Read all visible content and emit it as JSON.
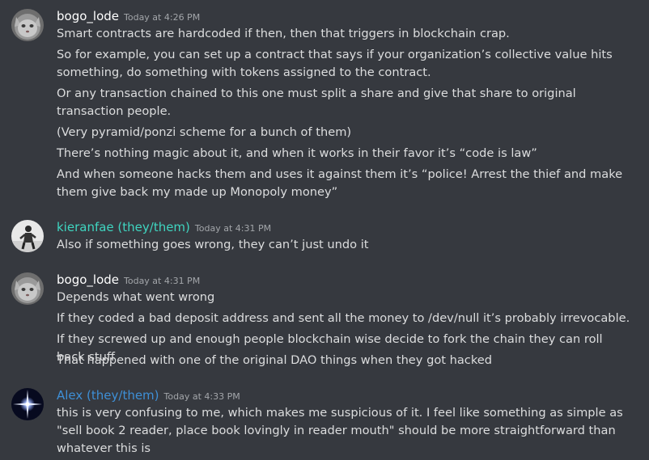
{
  "colors": {
    "background": "#36393f",
    "text": "#dcddde",
    "timestamp": "#a3a6aa",
    "username_default": "#ffffff",
    "username_teal": "#3fd5c0",
    "username_blue": "#3e8fd6"
  },
  "messages": [
    {
      "author": "bogo_lode",
      "author_color": "#ffffff",
      "avatar_icon": "cat-avatar-icon",
      "timestamp": "Today at 4:26 PM",
      "lines": [
        "Smart contracts are hardcoded if then, then that triggers in blockchain crap.",
        "So for example, you can set up a contract that says if your organization’s collective value hits something, do something with tokens assigned to the contract.",
        "Or any transaction chained to this one must split a share and give that share to original transaction people.",
        "(Very pyramid/ponzi scheme for a bunch of them)",
        "There’s nothing magic about it, and when it works in their favor it’s “code is law”",
        "And when someone hacks them and uses it against them it’s “police! Arrest the thief and make them give back my made up Monopoly money”"
      ]
    },
    {
      "author": "kieranfae (they/them)",
      "author_color": "#3fd5c0",
      "avatar_icon": "person-photo-avatar-icon",
      "timestamp": "Today at 4:31 PM",
      "lines": [
        "Also if something goes wrong, they can’t just undo it"
      ]
    },
    {
      "author": "bogo_lode",
      "author_color": "#ffffff",
      "avatar_icon": "cat-avatar-icon",
      "timestamp": "Today at 4:31 PM",
      "lines": [
        "Depends what went wrong",
        "If they coded a bad deposit address and sent all the money to /dev/null it’s probably irrevocable.",
        "If they screwed up and enough people blockchain wise decide to fork the chain they can roll back stuff",
        "That happened with one of the original DAO things when they got hacked"
      ]
    },
    {
      "author": "Alex (they/them)",
      "author_color": "#3e8fd6",
      "avatar_icon": "star-burst-avatar-icon",
      "timestamp": "Today at 4:33 PM",
      "lines": [
        "this is very confusing to me, which makes me suspicious of it. I feel like something as simple as \"sell book 2 reader, place book lovingly in reader mouth\" should be more straightforward than whatever this is"
      ]
    }
  ]
}
